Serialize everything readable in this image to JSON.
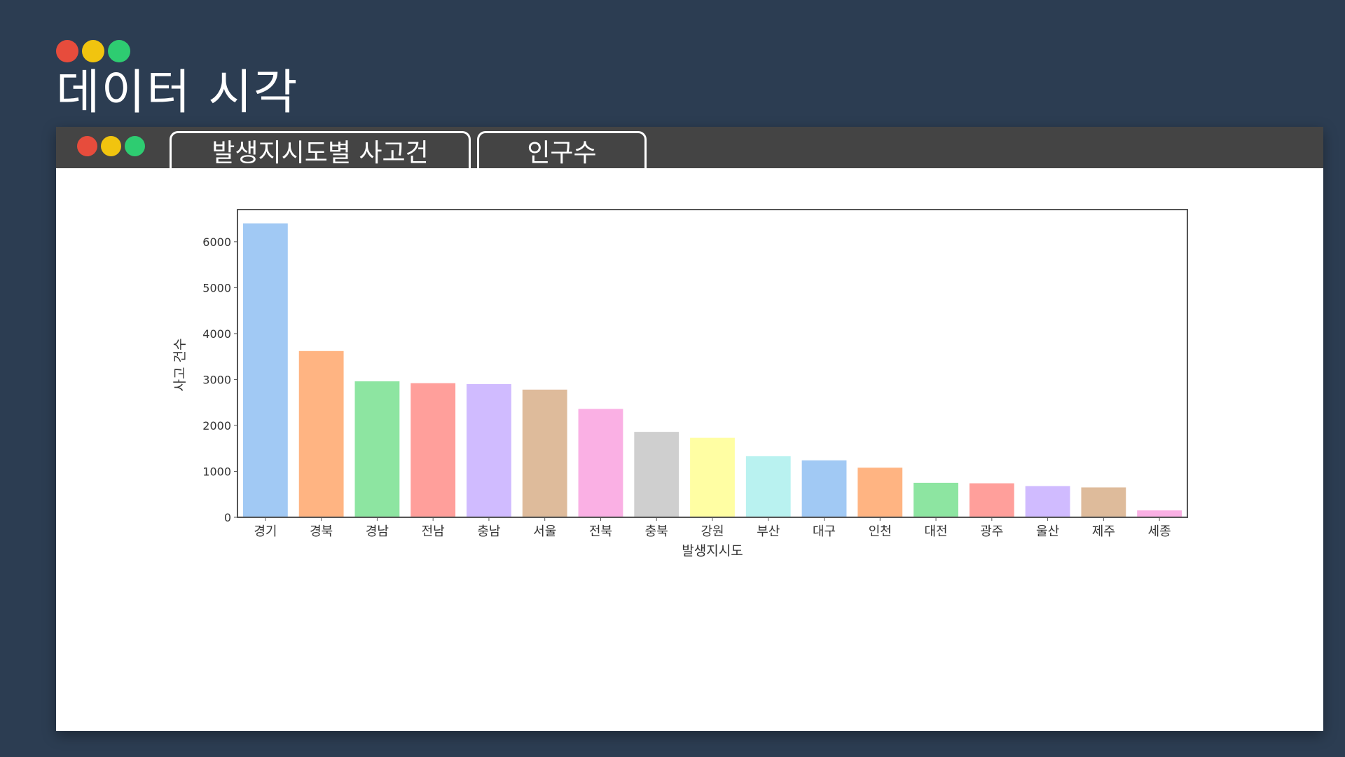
{
  "page": {
    "title": "데이터 시각",
    "dots": [
      "#e74c3c",
      "#f1c40f",
      "#2ecc71"
    ]
  },
  "window": {
    "tabs": [
      {
        "label": "발생지시도별 사고건"
      },
      {
        "label": "인구수"
      }
    ]
  },
  "chart_data": {
    "type": "bar",
    "categories": [
      "경기",
      "경북",
      "경남",
      "전남",
      "충남",
      "서울",
      "전북",
      "충북",
      "강원",
      "부산",
      "대구",
      "인천",
      "대전",
      "광주",
      "울산",
      "제주",
      "세종"
    ],
    "values": [
      6400,
      3620,
      2960,
      2920,
      2900,
      2780,
      2360,
      1860,
      1730,
      1330,
      1240,
      1080,
      750,
      740,
      680,
      650,
      150
    ],
    "colors": [
      "#a1c9f4",
      "#ffb482",
      "#8de5a1",
      "#ff9f9b",
      "#d0bbff",
      "#debb9b",
      "#fab0e4",
      "#cfcfcf",
      "#fffea3",
      "#b9f2f0",
      "#a1c9f4",
      "#ffb482",
      "#8de5a1",
      "#ff9f9b",
      "#d0bbff",
      "#debb9b",
      "#fab0e4"
    ],
    "xlabel": "발생지시도",
    "ylabel": "사고 건수",
    "ylim": [
      0,
      6700
    ],
    "yticks": [
      0,
      1000,
      2000,
      3000,
      4000,
      5000,
      6000
    ],
    "grid": false,
    "legend": "none"
  }
}
